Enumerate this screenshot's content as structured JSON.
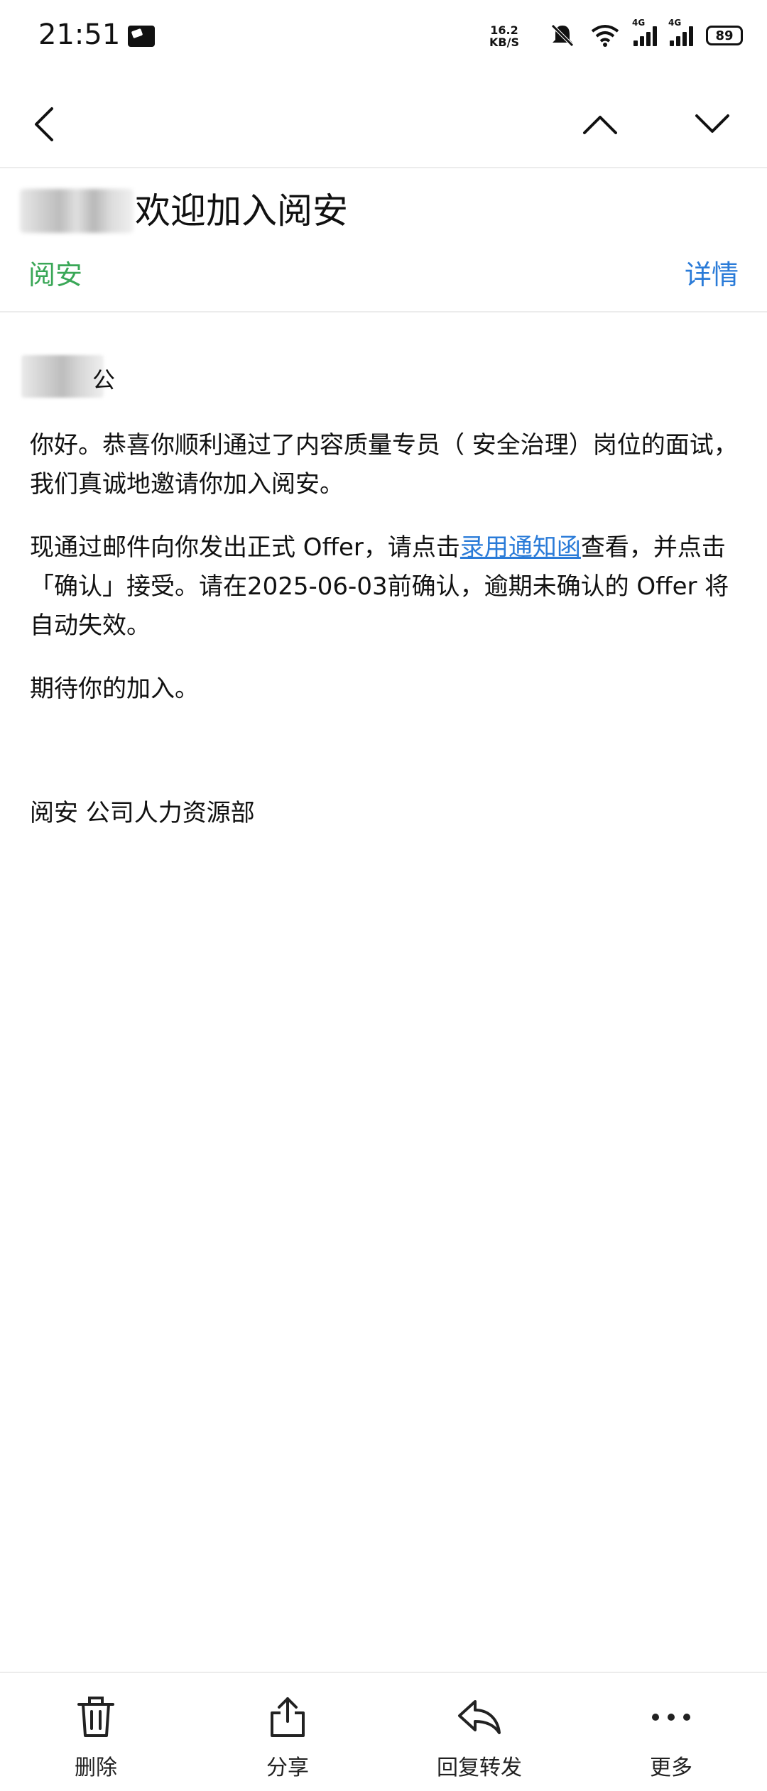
{
  "status_bar": {
    "time": "21:51",
    "net_speed_value": "16.2",
    "net_speed_unit": "KB/S",
    "signal1_tag": "4G",
    "signal2_tag": "4G",
    "battery": "89"
  },
  "email": {
    "subject": "欢迎加入阅安",
    "sender": "阅安",
    "details_label": "详情",
    "greeting_suffix": "公",
    "paragraph1": "你好。恭喜你顺利通过了内容质量专员（ 安全治理）岗位的面试，我们真诚地邀请你加入阅安。",
    "paragraph2_before": "现通过邮件向你发出正式 Offer，请点击",
    "paragraph2_link": "录用通知函",
    "paragraph2_after": "查看，并点击「确认」接受。请在2025-06-03前确认，逾期未确认的 Offer 将自动失效。",
    "paragraph3": "期待你的加入。",
    "signature": "阅安 公司人力资源部"
  },
  "toolbar": {
    "delete_label": "删除",
    "share_label": "分享",
    "reply_label": "回复转发",
    "more_label": "更多"
  },
  "colors": {
    "sender_green": "#3aa757",
    "link_blue": "#2a7bd8"
  }
}
